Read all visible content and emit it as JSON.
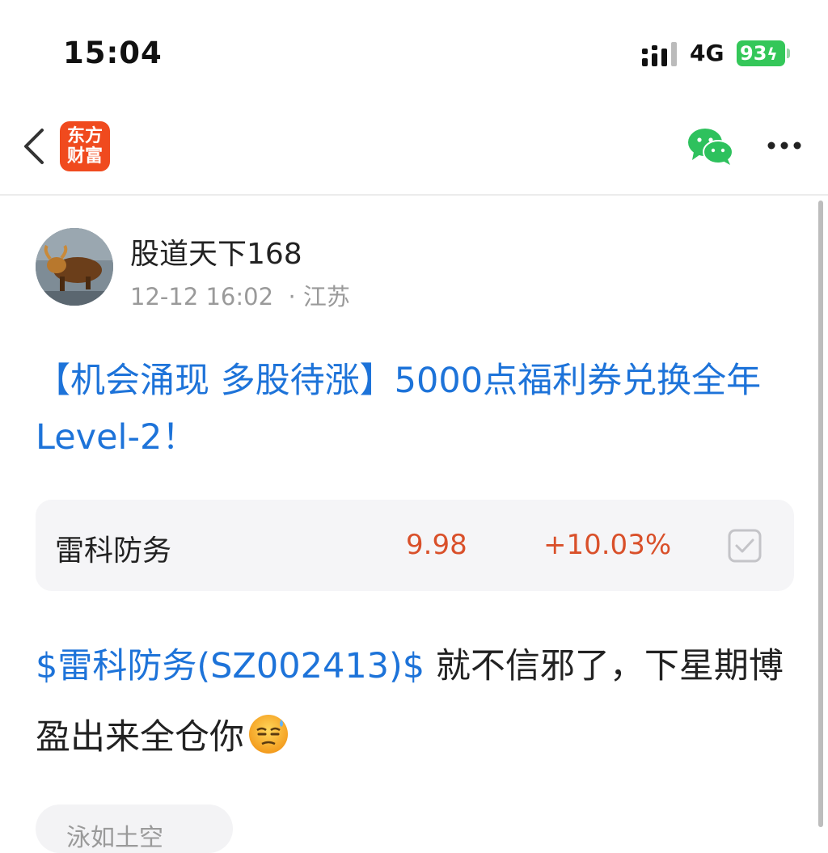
{
  "status_bar": {
    "time": "15:04",
    "network": "4G",
    "battery": "93"
  },
  "nav": {
    "app_logo_line1": "东方",
    "app_logo_line2": "财富",
    "logo_color": "#f04a1e",
    "icons": [
      "back-icon",
      "wechat-icon",
      "more-icon"
    ]
  },
  "post": {
    "author": "股道天下168",
    "meta": "12-12 16:02  · 江苏",
    "title": "【机会涌现 多股待涨】5000点福利券兑换全年Level-2！",
    "stock_card": {
      "name": "雷科防务",
      "price": "9.98",
      "change": "+10.03%"
    },
    "body_link": "$雷科防务(SZ002413)$",
    "body_text": " 就不信邪了，下星期博盈出来全仓你",
    "tag": "泳如土空"
  },
  "colors": {
    "link": "#1d73d9",
    "up": "#d9502a",
    "battery": "#34c759"
  }
}
